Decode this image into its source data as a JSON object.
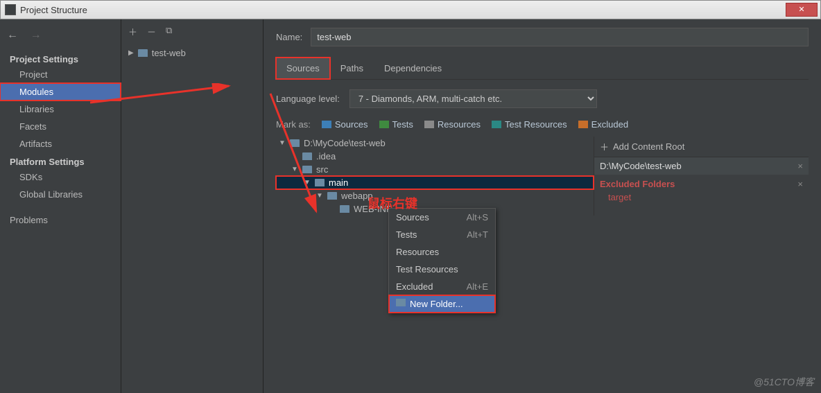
{
  "window": {
    "title": "Project Structure"
  },
  "sidebar": {
    "headings": {
      "project": "Project Settings",
      "platform": "Platform Settings"
    },
    "items": {
      "project": "Project",
      "modules": "Modules",
      "libraries": "Libraries",
      "facets": "Facets",
      "artifacts": "Artifacts",
      "sdks": "SDKs",
      "globalLibs": "Global Libraries",
      "problems": "Problems"
    }
  },
  "moduleList": {
    "item0": "test-web"
  },
  "form": {
    "nameLabel": "Name:",
    "nameValue": "test-web",
    "tabs": {
      "sources": "Sources",
      "paths": "Paths",
      "deps": "Dependencies"
    },
    "langLabel": "Language level:",
    "langValue": "7 - Diamonds, ARM, multi-catch etc.",
    "markLabel": "Mark as:",
    "marks": {
      "sources": "Sources",
      "tests": "Tests",
      "resources": "Resources",
      "testRes": "Test Resources",
      "excluded": "Excluded"
    }
  },
  "tree": {
    "root": "D:\\MyCode\\test-web",
    "idea": ".idea",
    "src": "src",
    "main": "main",
    "webapp": "webapp",
    "webinf": "WEB-INF"
  },
  "rightPanel": {
    "addRoot": "Add Content Root",
    "rootPath": "D:\\MyCode\\test-web",
    "excludedHead": "Excluded Folders",
    "excludedItem": "target"
  },
  "contextMenu": {
    "sources": {
      "label": "Sources",
      "sc": "Alt+S"
    },
    "tests": {
      "label": "Tests",
      "sc": "Alt+T"
    },
    "resources": {
      "label": "Resources",
      "sc": ""
    },
    "testRes": {
      "label": "Test Resources",
      "sc": ""
    },
    "excluded": {
      "label": "Excluded",
      "sc": "Alt+E"
    },
    "newFolder": {
      "label": "New Folder..."
    }
  },
  "annotation": {
    "rightClick": "鼠标右键"
  },
  "watermark": "@51CTO博客"
}
